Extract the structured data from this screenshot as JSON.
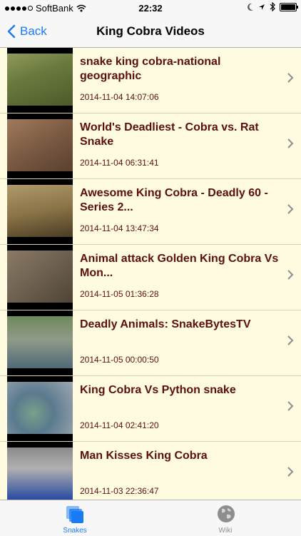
{
  "status_bar": {
    "carrier": "SoftBank",
    "time": "22:32"
  },
  "navbar": {
    "back_label": "Back",
    "title": "King Cobra Videos"
  },
  "videos": [
    {
      "title": "snake king cobra-national geographic",
      "date": "2014-11-04 14:07:06"
    },
    {
      "title": "World's Deadliest - Cobra vs. Rat Snake",
      "date": "2014-11-04 06:31:41"
    },
    {
      "title": "Awesome King Cobra - Deadly 60 - Series 2...",
      "date": "2014-11-04 13:47:34"
    },
    {
      "title": "Animal attack Golden King Cobra Vs Mon...",
      "date": "2014-11-05 01:36:28"
    },
    {
      "title": "Deadly Animals: SnakeBytesTV",
      "date": "2014-11-05 00:00:50"
    },
    {
      "title": "King Cobra Vs Python snake",
      "date": "2014-11-04 02:41:20"
    },
    {
      "title": "Man Kisses King Cobra",
      "date": "2014-11-03 22:36:47"
    }
  ],
  "tabbar": {
    "tabs": [
      {
        "label": "Snakes",
        "icon": "layers-icon",
        "selected": true
      },
      {
        "label": "Wiki",
        "icon": "globe-icon",
        "selected": false
      }
    ]
  },
  "colors": {
    "accent": "#1a7cf5",
    "row_text": "#5b0f0f",
    "row_bg": "#fffbe0"
  }
}
